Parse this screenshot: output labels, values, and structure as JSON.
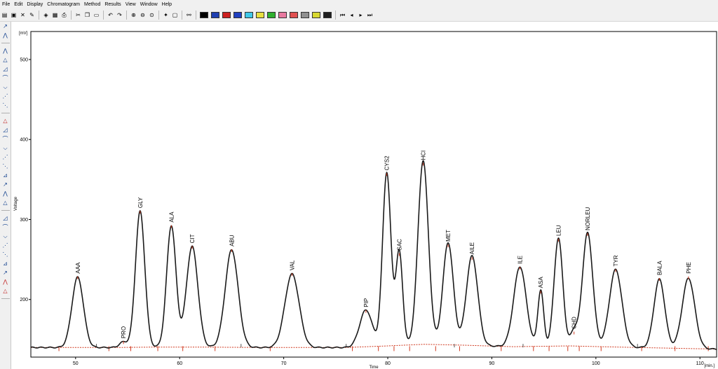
{
  "menu": [
    "File",
    "Edit",
    "Display",
    "Chromatogram",
    "Method",
    "Results",
    "View",
    "Window",
    "Help"
  ],
  "toolbar": {
    "groups": [
      [
        "open-icon",
        "save-icon",
        "close-icon",
        "edit-icon"
      ],
      [
        "method-icon",
        "sequence-icon",
        "print-icon"
      ],
      [
        "cut-icon",
        "copy-icon",
        "paste-icon"
      ],
      [
        "undo-icon",
        "redo-icon"
      ],
      [
        "zoom-in-icon",
        "zoom-out-icon",
        "zoom-reset-icon"
      ],
      [
        "tool-icon",
        "comment-icon"
      ],
      [
        "link-icon"
      ]
    ],
    "colors": [
      "#000000",
      "#1f3fb0",
      "#cc2020",
      "#2040c0",
      "#40c8e8",
      "#e8e040",
      "#30b030",
      "#e87aa0",
      "#e05050",
      "#909090",
      "#d8d830",
      "#202020"
    ],
    "nav": [
      "first-icon",
      "prev-icon",
      "next-icon",
      "last-icon"
    ]
  },
  "sidebar_icons": [
    [
      "integration-icon",
      "manual-peak-icon"
    ],
    [
      "peak-start-icon",
      "peak-end-icon",
      "peak-width-icon",
      "tangent-icon",
      "valley-icon",
      "shoulder-icon",
      "baseline-icon"
    ],
    [
      "delete-peak-icon",
      "add-peak-icon",
      "split-peak-icon",
      "merge-peak-icon",
      "move-baseline-icon",
      "lock-baseline-icon",
      "forward-horizontal-icon",
      "backward-horizontal-icon",
      "front-tangent-icon",
      "rear-tangent-icon"
    ],
    [
      "negative-peak-icon",
      "dashed-baseline-icon",
      "calibrate-icon",
      "threshold-icon",
      "peak-label-icon",
      "identify-icon",
      "disabled-icon",
      "red-mark-icon",
      "red-tool-icon"
    ]
  ],
  "chart_data": {
    "type": "line",
    "ylabel_unit": "[mV]",
    "ylabel": "Voltage",
    "xlabel": "Time",
    "xlabel_unit": "[min.]",
    "xlim": [
      45.7,
      111.6
    ],
    "ylim": [
      128,
      535
    ],
    "x_ticks": [
      50,
      60,
      70,
      80,
      90,
      100,
      110
    ],
    "y_ticks": [
      200,
      300,
      400,
      500
    ],
    "baseline_y": 140,
    "peaks": [
      {
        "name": "AAA",
        "rt": 50.2,
        "height": 228,
        "width": 0.55
      },
      {
        "name": "PRO",
        "rt": 54.6,
        "height": 147,
        "width": 0.38
      },
      {
        "name": "GLY",
        "rt": 56.2,
        "height": 310,
        "width": 0.45
      },
      {
        "name": "ALA",
        "rt": 59.2,
        "height": 292,
        "width": 0.45
      },
      {
        "name": "CIT",
        "rt": 61.2,
        "height": 266,
        "width": 0.55
      },
      {
        "name": "ABU",
        "rt": 65.0,
        "height": 262,
        "width": 0.62
      },
      {
        "name": "VAL",
        "rt": 70.8,
        "height": 232,
        "width": 0.68
      },
      {
        "name": "PIP",
        "rt": 77.9,
        "height": 186,
        "width": 0.6
      },
      {
        "name": "CYS2",
        "rt": 79.9,
        "height": 357,
        "width": 0.4
      },
      {
        "name": "SAC",
        "rt": 81.1,
        "height": 257,
        "width": 0.33
      },
      {
        "name": "HCI",
        "rt": 83.4,
        "height": 370,
        "width": 0.5
      },
      {
        "name": "MET",
        "rt": 85.8,
        "height": 268,
        "width": 0.5
      },
      {
        "name": "AILE",
        "rt": 88.1,
        "height": 252,
        "width": 0.55
      },
      {
        "name": "ILE",
        "rt": 92.7,
        "height": 240,
        "width": 0.6
      },
      {
        "name": "ASA",
        "rt": 94.7,
        "height": 210,
        "width": 0.28
      },
      {
        "name": "LEU",
        "rt": 96.4,
        "height": 275,
        "width": 0.42
      },
      {
        "name": "CHD",
        "rt": 97.9,
        "height": 159,
        "width": 0.32
      },
      {
        "name": "NORLEU",
        "rt": 99.2,
        "height": 282,
        "width": 0.5
      },
      {
        "name": "TYR",
        "rt": 101.9,
        "height": 237,
        "width": 0.6
      },
      {
        "name": "BALA",
        "rt": 106.1,
        "height": 226,
        "width": 0.52
      },
      {
        "name": "PHE",
        "rt": 108.9,
        "height": 228,
        "width": 0.6
      }
    ],
    "baseline_segments": [
      [
        45.7,
        140
      ],
      [
        54.0,
        140
      ],
      [
        57.5,
        140.5
      ],
      [
        62.0,
        140.5
      ],
      [
        68.0,
        140
      ],
      [
        76.0,
        140
      ],
      [
        80.0,
        142
      ],
      [
        83.5,
        144
      ],
      [
        87.0,
        143
      ],
      [
        92.0,
        141
      ],
      [
        97.5,
        142
      ],
      [
        100.5,
        141
      ],
      [
        104.0,
        140
      ],
      [
        111.6,
        138
      ]
    ],
    "colors": {
      "trace": "#1a1a1a",
      "baseline": "#d03a20",
      "axis": "#000000"
    }
  }
}
